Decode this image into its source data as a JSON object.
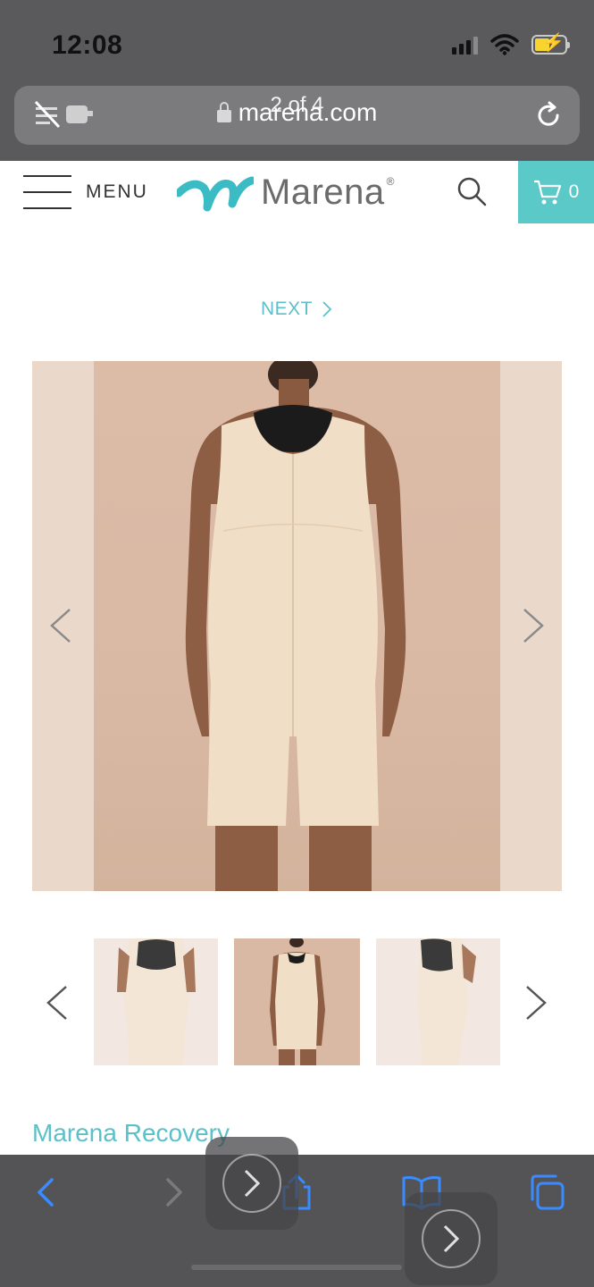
{
  "status_bar": {
    "time": "12:08"
  },
  "browser": {
    "domain": "marena.com",
    "find_overlay": "2 of 4"
  },
  "header": {
    "menu_label": "MENU",
    "logo_text": "Marena",
    "cart_count": "0",
    "cart_color": "#5bc9c8"
  },
  "product": {
    "next_label": "NEXT",
    "title": "Marena Recovery",
    "accent_color": "#5bc0c8"
  },
  "icons": {
    "url_left": "reader-off-icon",
    "lock": "lock-icon",
    "reload": "reload-icon",
    "search": "search-icon",
    "cart": "cart-icon",
    "back": "back-arrow-icon",
    "forward": "forward-arrow-icon",
    "share": "share-icon",
    "bookmarks": "bookmarks-icon",
    "tabs": "tabs-icon"
  }
}
